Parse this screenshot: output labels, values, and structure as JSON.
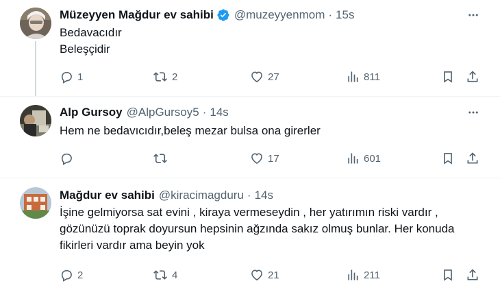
{
  "tweets": [
    {
      "name": "Müzeyyen Mağdur ev sahibi",
      "verified": true,
      "handle": "@muzeyyenmom",
      "separator": "·",
      "time": "15s",
      "lines": [
        "Bedavacıdır",
        "Beleşçidir"
      ],
      "replies": "1",
      "retweets": "2",
      "likes": "27",
      "views": "811"
    },
    {
      "name": "Alp Gursoy",
      "verified": false,
      "handle": "@AlpGursoy5",
      "separator": "·",
      "time": "14s",
      "lines": [
        "Hem ne bedavıcıdır,beleş mezar bulsa ona girerler"
      ],
      "replies": "",
      "retweets": "",
      "likes": "17",
      "views": "601"
    },
    {
      "name": "Mağdur ev sahibi",
      "verified": false,
      "handle": "@kiracimagduru",
      "separator": "·",
      "time": "14s",
      "lines": [
        "İşine gelmiyorsa sat evini , kiraya vermeseydin , her yatırımın riski vardır ,",
        "gözünüzü toprak doyursun hepsinin ağzında sakız olmuş bunlar. Her konuda",
        "fikirleri vardır ama beyin yok"
      ],
      "replies": "2",
      "retweets": "4",
      "likes": "21",
      "views": "211"
    }
  ],
  "colors": {
    "text": "#0f1419",
    "muted": "#536471",
    "verified": "#1d9bf0",
    "divider": "#eff3f4"
  }
}
